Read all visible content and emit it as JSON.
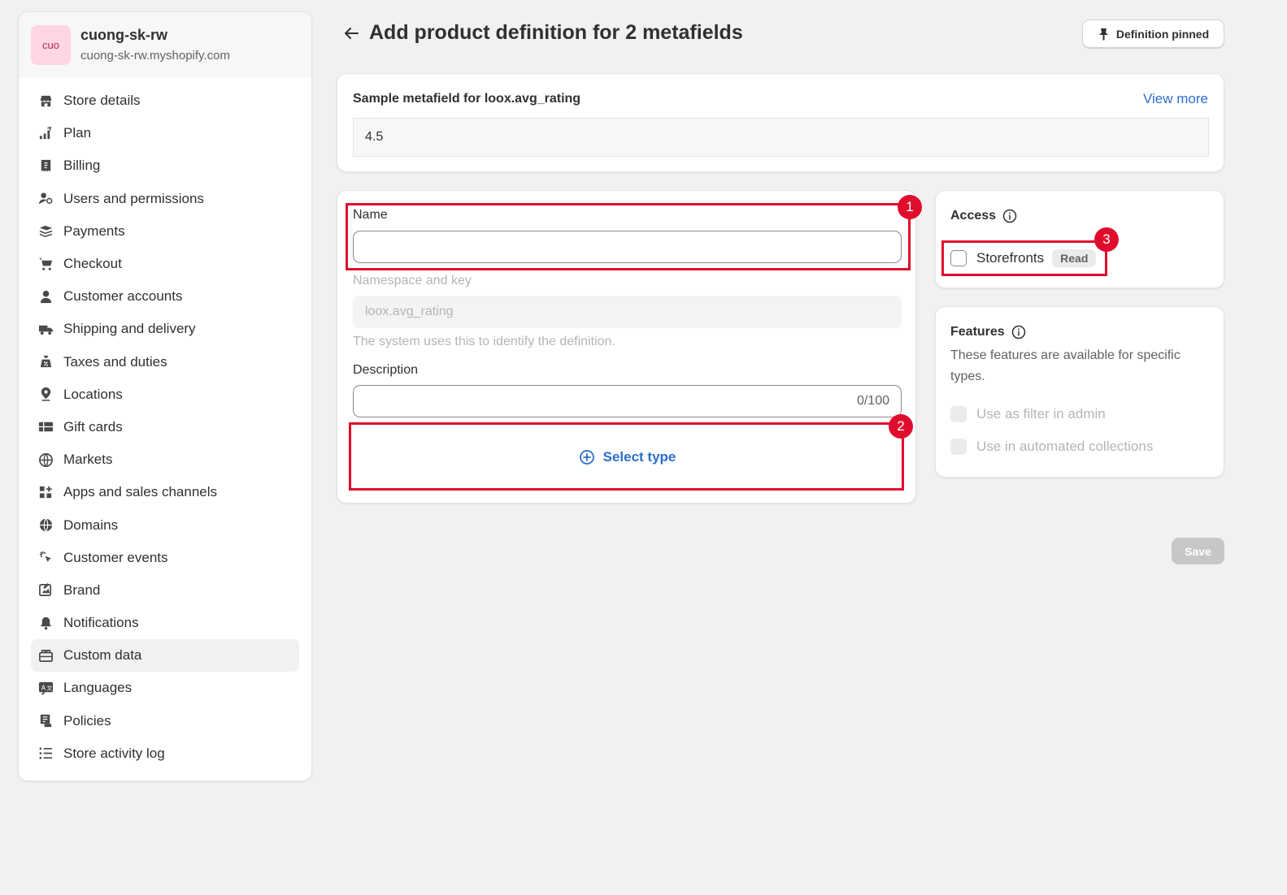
{
  "store": {
    "initials": "cuo",
    "name": "cuong-sk-rw",
    "url": "cuong-sk-rw.myshopify.com"
  },
  "sidebar": {
    "items": [
      {
        "label": "Store details",
        "icon": "store-icon"
      },
      {
        "label": "Plan",
        "icon": "plan-icon"
      },
      {
        "label": "Billing",
        "icon": "billing-icon"
      },
      {
        "label": "Users and permissions",
        "icon": "users-icon"
      },
      {
        "label": "Payments",
        "icon": "payments-icon"
      },
      {
        "label": "Checkout",
        "icon": "cart-icon"
      },
      {
        "label": "Customer accounts",
        "icon": "person-icon"
      },
      {
        "label": "Shipping and delivery",
        "icon": "truck-icon"
      },
      {
        "label": "Taxes and duties",
        "icon": "taxes-icon"
      },
      {
        "label": "Locations",
        "icon": "location-icon"
      },
      {
        "label": "Gift cards",
        "icon": "gift-card-icon"
      },
      {
        "label": "Markets",
        "icon": "globe-icon"
      },
      {
        "label": "Apps and sales channels",
        "icon": "apps-icon"
      },
      {
        "label": "Domains",
        "icon": "domains-icon"
      },
      {
        "label": "Customer events",
        "icon": "cursor-click-icon"
      },
      {
        "label": "Brand",
        "icon": "brand-icon"
      },
      {
        "label": "Notifications",
        "icon": "bell-icon"
      },
      {
        "label": "Custom data",
        "icon": "custom-data-icon",
        "active": true
      },
      {
        "label": "Languages",
        "icon": "languages-icon"
      },
      {
        "label": "Policies",
        "icon": "policies-icon"
      },
      {
        "label": "Store activity log",
        "icon": "list-icon"
      }
    ]
  },
  "header": {
    "title": "Add product definition for 2 metafields",
    "pin_label": "Definition pinned"
  },
  "sample": {
    "label": "Sample metafield for loox.avg_rating",
    "view_more": "View more",
    "value": "4.5"
  },
  "form": {
    "name_label": "Name",
    "name_value": "",
    "namespace_label": "Namespace and key",
    "namespace_value": "loox.avg_rating",
    "namespace_help": "The system uses this to identify the definition.",
    "description_label": "Description",
    "description_value": "",
    "description_counter": "0/100",
    "select_type": "Select type"
  },
  "access": {
    "title": "Access",
    "storefronts_label": "Storefronts",
    "storefronts_badge": "Read"
  },
  "features": {
    "title": "Features",
    "description": "These features are available for specific types.",
    "options": [
      "Use as filter in admin",
      "Use in automated collections"
    ]
  },
  "actions": {
    "save": "Save"
  },
  "annotations": [
    "1",
    "2",
    "3"
  ],
  "colors": {
    "accent": "#2c6ecb",
    "annotation": "#e00c2e",
    "avatar_bg": "#ffd6e3"
  }
}
